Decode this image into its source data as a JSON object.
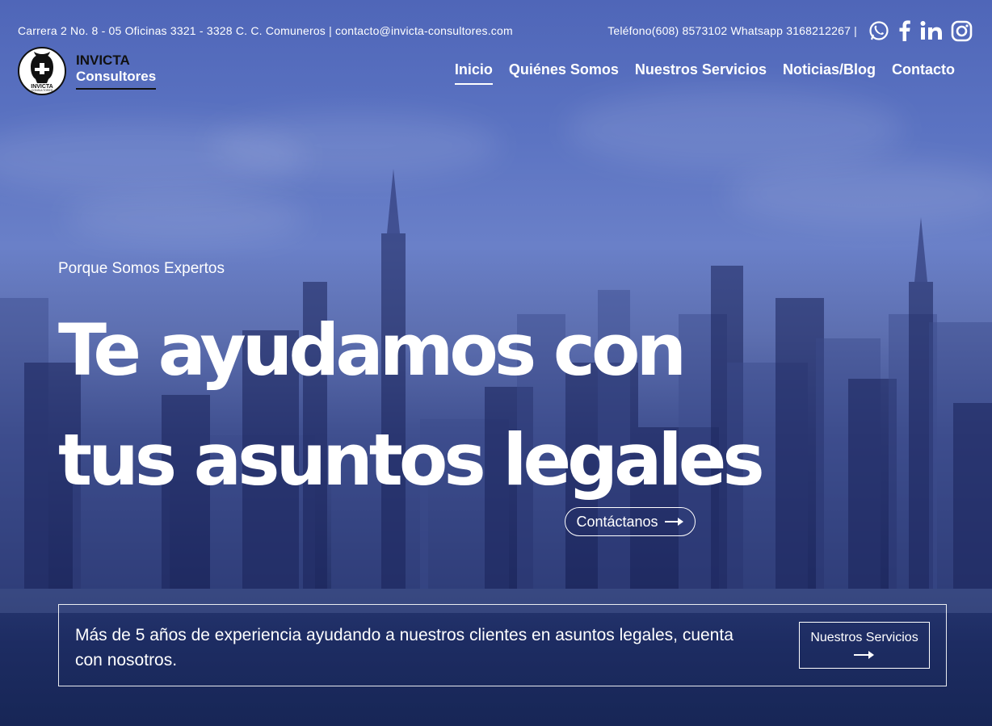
{
  "topbar": {
    "address": "Carrera 2 No. 8 - 05 Oficinas 3321 - 3328 C. C. Comuneros | contacto@invicta-consultores.com",
    "phone": "Teléfono(608) 8573102 Whatsapp 3168212267 |",
    "social_icons": [
      "whatsapp-icon",
      "facebook-icon",
      "linkedin-icon",
      "instagram-icon"
    ]
  },
  "logo": {
    "line1": "INVICTA",
    "line2": "Consultores",
    "emblem_text": "INVICTA",
    "emblem_subtext": "CONSULTORES"
  },
  "nav": {
    "items": [
      "Inicio",
      "Quiénes Somos",
      "Nuestros Servicios",
      "Noticias/Blog",
      "Contacto"
    ],
    "active": "Inicio"
  },
  "hero": {
    "eyebrow": "Porque Somos Expertos",
    "headline_line1": "Te ayudamos con",
    "headline_line2": "tus asuntos legales",
    "cta_label": "Contáctanos"
  },
  "info": {
    "text": "Más de 5 años de experiencia ayudando a nuestros clientes en asuntos legales, cuenta con nosotros.",
    "button_label": "Nuestros Servicios"
  },
  "colors": {
    "overlay_top": "#5b73c2",
    "overlay_bottom": "#1a2a5c",
    "text": "#ffffff",
    "logo_dark": "#111111"
  }
}
